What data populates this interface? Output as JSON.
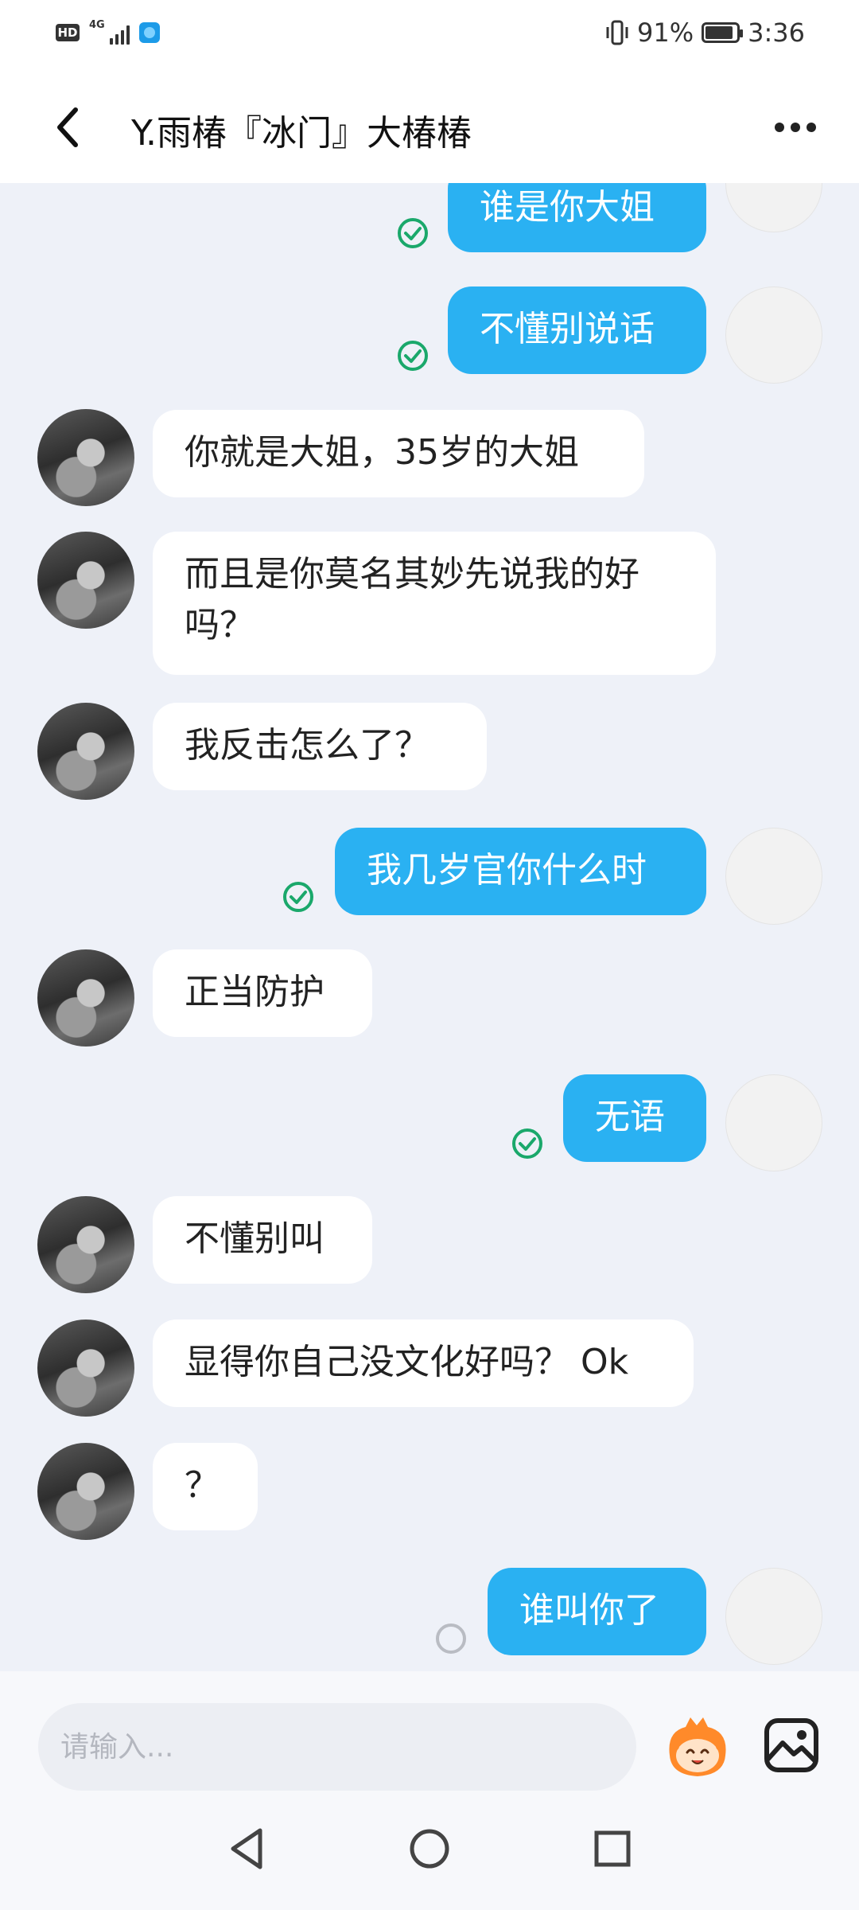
{
  "status_bar": {
    "hd": "HD",
    "network": "4G",
    "battery_percent": "91%",
    "battery_level": 0.91,
    "time": "3:36"
  },
  "header": {
    "title": "Y.雨椿『冰门』大椿椿"
  },
  "messages": [
    {
      "side": "out",
      "text": "谁是你大姐",
      "status": "sent"
    },
    {
      "side": "out",
      "text": "不懂别说话",
      "status": "sent"
    },
    {
      "side": "in",
      "text": "你就是大姐，35岁的大姐"
    },
    {
      "side": "in",
      "text": "而且是你莫名其妙先说我的好吗？"
    },
    {
      "side": "in",
      "text": "我反击怎么了？"
    },
    {
      "side": "out",
      "text": "我几岁官你什么时",
      "status": "sent"
    },
    {
      "side": "in",
      "text": "正当防护"
    },
    {
      "side": "out",
      "text": "无语",
      "status": "sent"
    },
    {
      "side": "in",
      "text": "不懂别叫"
    },
    {
      "side": "in",
      "text": "显得你自己没文化好吗？ Ok"
    },
    {
      "side": "in",
      "text": "？"
    },
    {
      "side": "out",
      "text": "谁叫你了",
      "status": "pending"
    }
  ],
  "input": {
    "placeholder": "请输入..."
  },
  "icons": {
    "back": "back-arrow-icon",
    "more": "more-dots-icon",
    "emoji": "emoji-mascot-icon",
    "image": "image-icon",
    "sent": "check-circle-icon",
    "pending": "pending-circle-icon",
    "nav_back": "triangle-back-icon",
    "nav_home": "circle-home-icon",
    "nav_recent": "square-recent-icon"
  },
  "colors": {
    "outgoing_bubble": "#2ab1f2",
    "incoming_bubble": "#ffffff",
    "chat_background": "#eef1f8",
    "sent_check": "#1aa86b"
  }
}
